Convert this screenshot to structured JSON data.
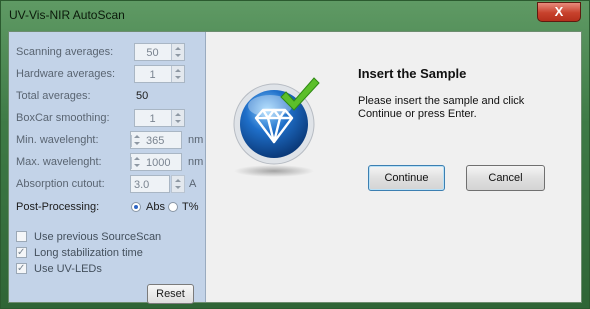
{
  "window": {
    "title": "UV-Vis-NIR AutoScan",
    "close_glyph": "X"
  },
  "settings": {
    "scanning_averages": {
      "label": "Scanning averages:",
      "value": "50"
    },
    "hardware_averages": {
      "label": "Hardware averages:",
      "value": "1"
    },
    "total_averages": {
      "label": "Total averages:",
      "value": "50"
    },
    "boxcar_smoothing": {
      "label": "BoxCar smoothing:",
      "value": "1"
    },
    "min_wavelength": {
      "label": "Min. wavelenght:",
      "value": "365",
      "unit": "nm"
    },
    "max_wavelength": {
      "label": "Max. wavelenght:",
      "value": "1000",
      "unit": "nm"
    },
    "absorption_cutout": {
      "label": "Absorption cutout:",
      "value": "3.0",
      "unit": "A"
    },
    "post_processing": {
      "label": "Post-Processing:",
      "options": [
        "Abs",
        "T%"
      ],
      "selected": "Abs"
    },
    "use_previous_sourcescan": {
      "label": "Use previous SourceScan",
      "checked": false
    },
    "long_stabilization": {
      "label": "Long stabilization time",
      "checked": true
    },
    "use_uv_leds": {
      "label": "Use UV-LEDs",
      "checked": true
    },
    "reset_label": "Reset"
  },
  "dialog": {
    "icon": "diamond-checkmark-icon",
    "heading": "Insert the Sample",
    "message": "Please insert the sample and click Continue or press Enter.",
    "continue_label": "Continue",
    "cancel_label": "Cancel"
  },
  "colors": {
    "title_bar": "#3e7a46",
    "side_panel": "#c3d3e8",
    "close_button": "#c7412c",
    "icon_blue": "#1f6fc9",
    "check_green": "#5cbf2a"
  }
}
